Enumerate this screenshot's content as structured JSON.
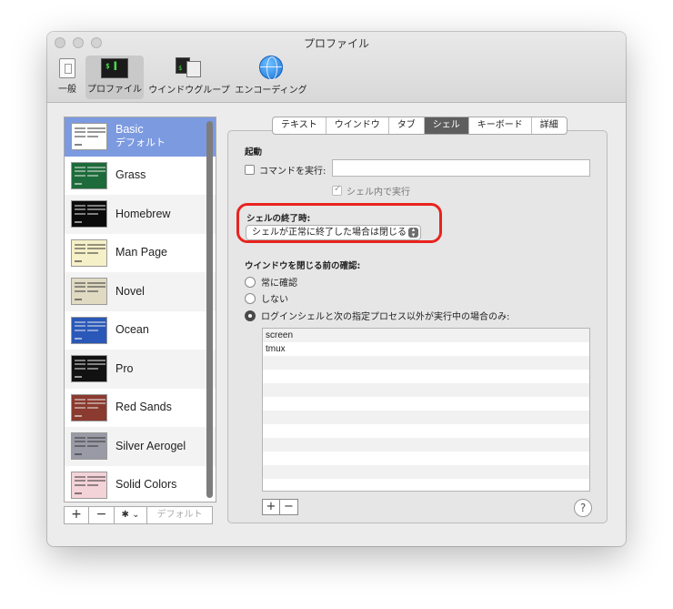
{
  "window": {
    "title": "プロファイル"
  },
  "toolbar": {
    "items": [
      {
        "label": "一般",
        "icon": "general-icon"
      },
      {
        "label": "プロファイル",
        "icon": "profiles-icon",
        "icon_text": "$ ▌"
      },
      {
        "label": "ウインドウグループ",
        "icon": "window-groups-icon"
      },
      {
        "label": "エンコーディング",
        "icon": "globe-icon"
      }
    ],
    "active": "プロファイル"
  },
  "profiles": [
    {
      "name": "Basic",
      "subtitle": "デフォルト",
      "color": "#ffffff",
      "selected": true
    },
    {
      "name": "Grass",
      "color": "#1d6b3a"
    },
    {
      "name": "Homebrew",
      "color": "#0b0b0b"
    },
    {
      "name": "Man Page",
      "color": "#f5f0c8"
    },
    {
      "name": "Novel",
      "color": "#e0dac3"
    },
    {
      "name": "Ocean",
      "color": "#2a58b8"
    },
    {
      "name": "Pro",
      "color": "#111111"
    },
    {
      "name": "Red Sands",
      "color": "#8a3a2e"
    },
    {
      "name": "Silver Aerogel",
      "color": "#9a9aa6"
    },
    {
      "name": "Solid Colors",
      "color": "#f3d2d8"
    }
  ],
  "sidebar_buttons": {
    "add": "+",
    "remove": "−",
    "gear": "✱ ⌄",
    "default": "デフォルト"
  },
  "tabs": [
    "テキスト",
    "ウインドウ",
    "タブ",
    "シェル",
    "キーボード",
    "詳細"
  ],
  "active_tab": "シェル",
  "startup": {
    "heading": "起動",
    "run_command_label": "コマンドを実行:",
    "run_command_value": "",
    "run_in_shell_label": "シェル内で実行"
  },
  "shell_exit": {
    "heading": "シェルの終了時:",
    "selected": "シェルが正常に終了した場合は閉じる"
  },
  "close_confirm": {
    "heading": "ウインドウを閉じる前の確認:",
    "options": [
      "常に確認",
      "しない",
      "ログインシェルと次の指定プロセス以外が実行中の場合のみ:"
    ],
    "selected_index": 2,
    "processes": [
      "screen",
      "tmux"
    ]
  },
  "list_buttons": {
    "add": "+",
    "remove": "−"
  },
  "help": "?"
}
